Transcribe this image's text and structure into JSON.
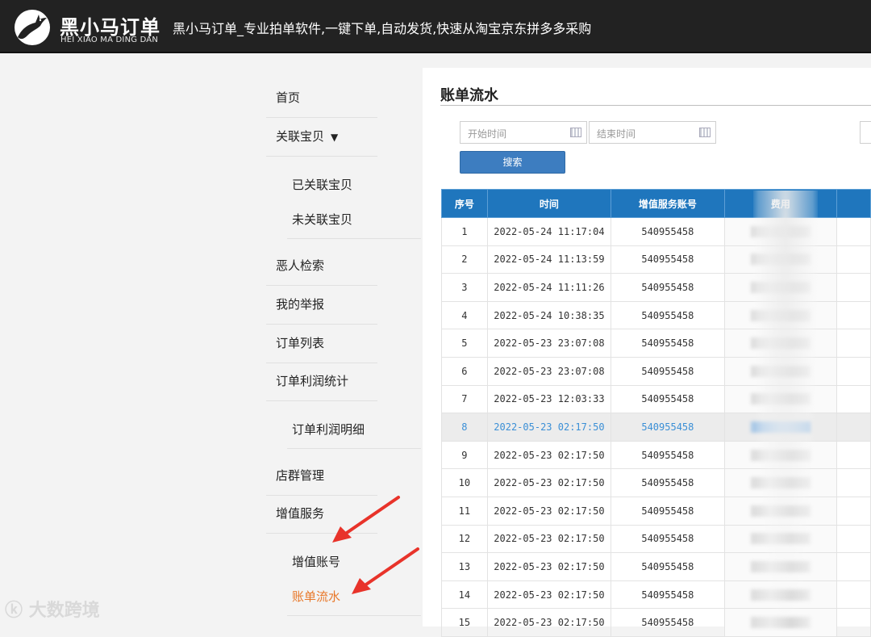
{
  "header": {
    "logo_cn": "黑小马订单",
    "logo_en": "HEI XIAO MA DING DAN",
    "title": "黑小马订单_专业拍单软件,一键下单,自动发货,快速从淘宝京东拼多多采购"
  },
  "sidebar": {
    "items": [
      {
        "label": "首页"
      },
      {
        "label": "关联宝贝",
        "caret": "▼"
      },
      {
        "label": "已关联宝贝"
      },
      {
        "label": "未关联宝贝"
      },
      {
        "label": "恶人检索"
      },
      {
        "label": "我的举报"
      },
      {
        "label": "订单列表"
      },
      {
        "label": "订单利润统计"
      },
      {
        "label": "订单利润明细"
      },
      {
        "label": "店群管理"
      },
      {
        "label": "增值服务"
      },
      {
        "label": "增值账号"
      },
      {
        "label": "账单流水"
      }
    ],
    "active_color": "#e8782a"
  },
  "watermark": "大数跨境",
  "main": {
    "title": "账单流水",
    "start_placeholder": "开始时间",
    "end_placeholder": "结束时间",
    "search_label": "搜索",
    "table": {
      "headers": [
        "序号",
        "时间",
        "增值服务账号",
        "费用"
      ],
      "rows": [
        {
          "no": "1",
          "time": "2022-05-24 11:17:04",
          "account": "540955458"
        },
        {
          "no": "2",
          "time": "2022-05-24 11:13:59",
          "account": "540955458"
        },
        {
          "no": "3",
          "time": "2022-05-24 11:11:26",
          "account": "540955458"
        },
        {
          "no": "4",
          "time": "2022-05-24 10:38:35",
          "account": "540955458"
        },
        {
          "no": "5",
          "time": "2022-05-23 23:07:08",
          "account": "540955458"
        },
        {
          "no": "6",
          "time": "2022-05-23 23:07:08",
          "account": "540955458"
        },
        {
          "no": "7",
          "time": "2022-05-23 12:03:33",
          "account": "540955458"
        },
        {
          "no": "8",
          "time": "2022-05-23 02:17:50",
          "account": "540955458"
        },
        {
          "no": "9",
          "time": "2022-05-23 02:17:50",
          "account": "540955458"
        },
        {
          "no": "10",
          "time": "2022-05-23 02:17:50",
          "account": "540955458"
        },
        {
          "no": "11",
          "time": "2022-05-23 02:17:50",
          "account": "540955458"
        },
        {
          "no": "12",
          "time": "2022-05-23 02:17:50",
          "account": "540955458"
        },
        {
          "no": "13",
          "time": "2022-05-23 02:17:50",
          "account": "540955458"
        },
        {
          "no": "14",
          "time": "2022-05-23 02:17:50",
          "account": "540955458"
        },
        {
          "no": "15",
          "time": "2022-05-23 02:17:50",
          "account": "540955458"
        }
      ],
      "highlight_color": "#3b8fd6",
      "header_color": "#1f76bd"
    }
  }
}
